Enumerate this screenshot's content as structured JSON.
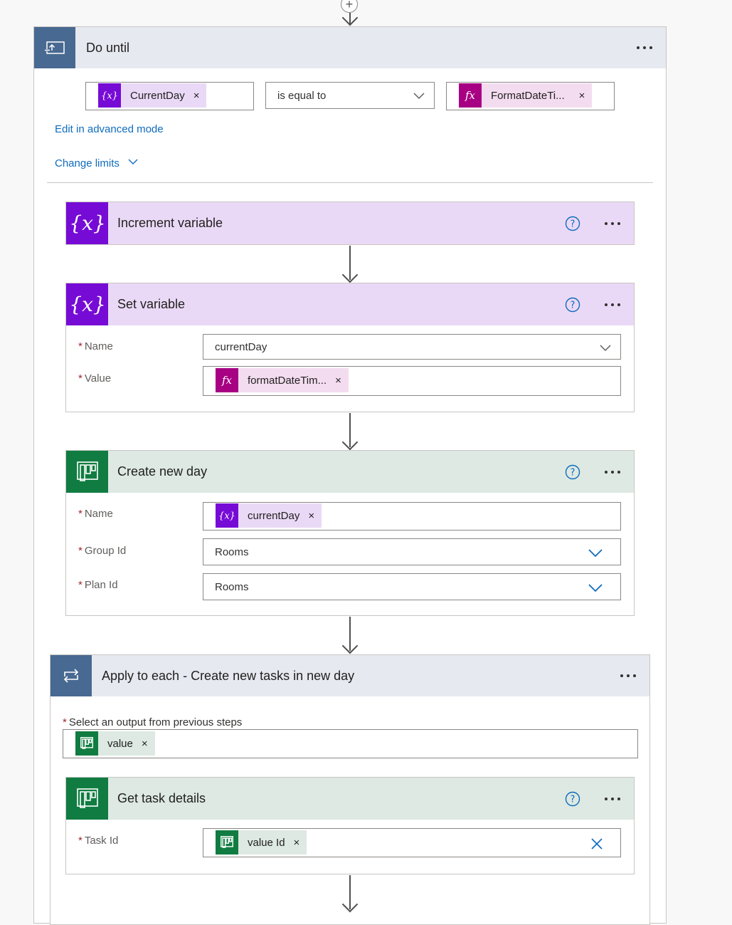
{
  "do_until": {
    "title": "Do until",
    "condition": {
      "left_token": "CurrentDay",
      "operator": "is equal to",
      "right_token": "FormatDateTi..."
    },
    "edit_advanced": "Edit in advanced mode",
    "change_limits": "Change limits"
  },
  "increment_variable": {
    "title": "Increment variable"
  },
  "set_variable": {
    "title": "Set variable",
    "name_label": "Name",
    "name_value": "currentDay",
    "value_label": "Value",
    "value_token": "formatDateTim..."
  },
  "create_new_day": {
    "title": "Create new day",
    "name_label": "Name",
    "name_token": "currentDay",
    "group_label": "Group Id",
    "group_value": "Rooms",
    "plan_label": "Plan Id",
    "plan_value": "Rooms"
  },
  "apply_to_each": {
    "title": "Apply to each - Create new tasks in new day",
    "select_label": "Select an output from previous steps",
    "select_token": "value"
  },
  "get_task_details": {
    "title": "Get task details",
    "task_label": "Task Id",
    "task_token": "value Id"
  },
  "common": {
    "required_mark": "*",
    "remove_glyph": "×",
    "add_glyph": "+"
  },
  "colors": {
    "scope_icon_bg": "#486991",
    "scope_header_bg": "#e6e9f0",
    "variables_icon_bg": "#770bd6",
    "variables_header_bg": "#ead9f6",
    "expression_icon_bg": "#a70083",
    "planner_icon_bg": "#107c41",
    "planner_header_bg": "#dde9e2",
    "link_color": "#0f6cbd"
  },
  "icons": {
    "do_until": "do-until-icon",
    "variable": "variable-icon",
    "expression": "fx-icon",
    "planner": "planner-icon",
    "loop": "loop-icon",
    "help": "help-icon",
    "more": "more-options-icon",
    "chevron": "chevron-down-icon",
    "clear": "clear-icon"
  }
}
